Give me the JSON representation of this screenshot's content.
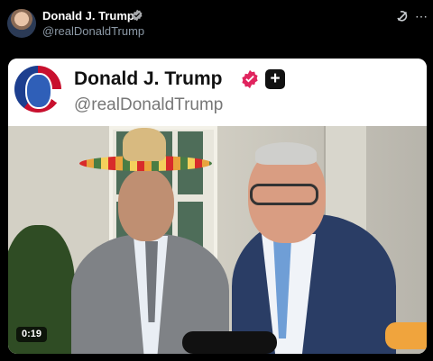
{
  "post": {
    "author_name": "Donald J. Trump",
    "author_handle": "@realDonaldTrump"
  },
  "embed": {
    "author_name": "Donald J. Trump",
    "author_handle": "@realDonaldTrump",
    "plus_label": "+"
  },
  "video": {
    "duration": "0:19"
  },
  "icons": {
    "verified": "verified-badge-icon",
    "grok": "grok-icon",
    "more": "more-icon",
    "plus": "plus-icon"
  },
  "colors": {
    "background": "#000000",
    "verified_blue": "#1d9bf0",
    "truth_social_badge": "#e0245e"
  }
}
